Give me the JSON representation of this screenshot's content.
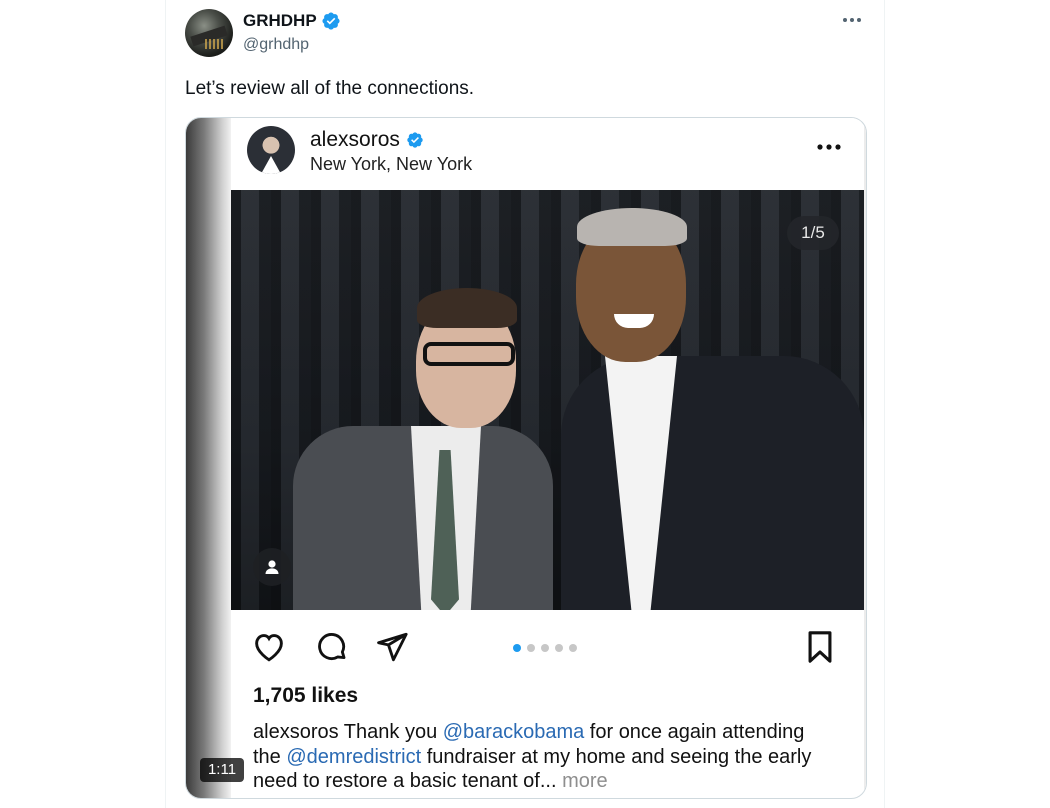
{
  "tweet": {
    "display_name": "GRHDHP",
    "handle": "@grhdhp",
    "text": "Let’s review all of the connections.",
    "verified_color": "#1d9bf0"
  },
  "video": {
    "duration": "1:11"
  },
  "instagram_post": {
    "username": "alexsoros",
    "location": "New York, New York",
    "image_counter": "1/5",
    "likes": "1,705 likes",
    "caption": {
      "author": "alexsoros",
      "part1": " Thank you ",
      "mention1": "@barackobama",
      "part2": " for once again attending the ",
      "mention2": "@demredistrict",
      "part3": " fundraiser at my home and seeing the early need to restore a basic tenant of... ",
      "more": "more"
    },
    "carousel": {
      "count": 5,
      "active_index": 0
    },
    "icons": [
      "heart-icon",
      "comment-icon",
      "share-icon",
      "bookmark-icon",
      "person-tag-icon"
    ]
  }
}
